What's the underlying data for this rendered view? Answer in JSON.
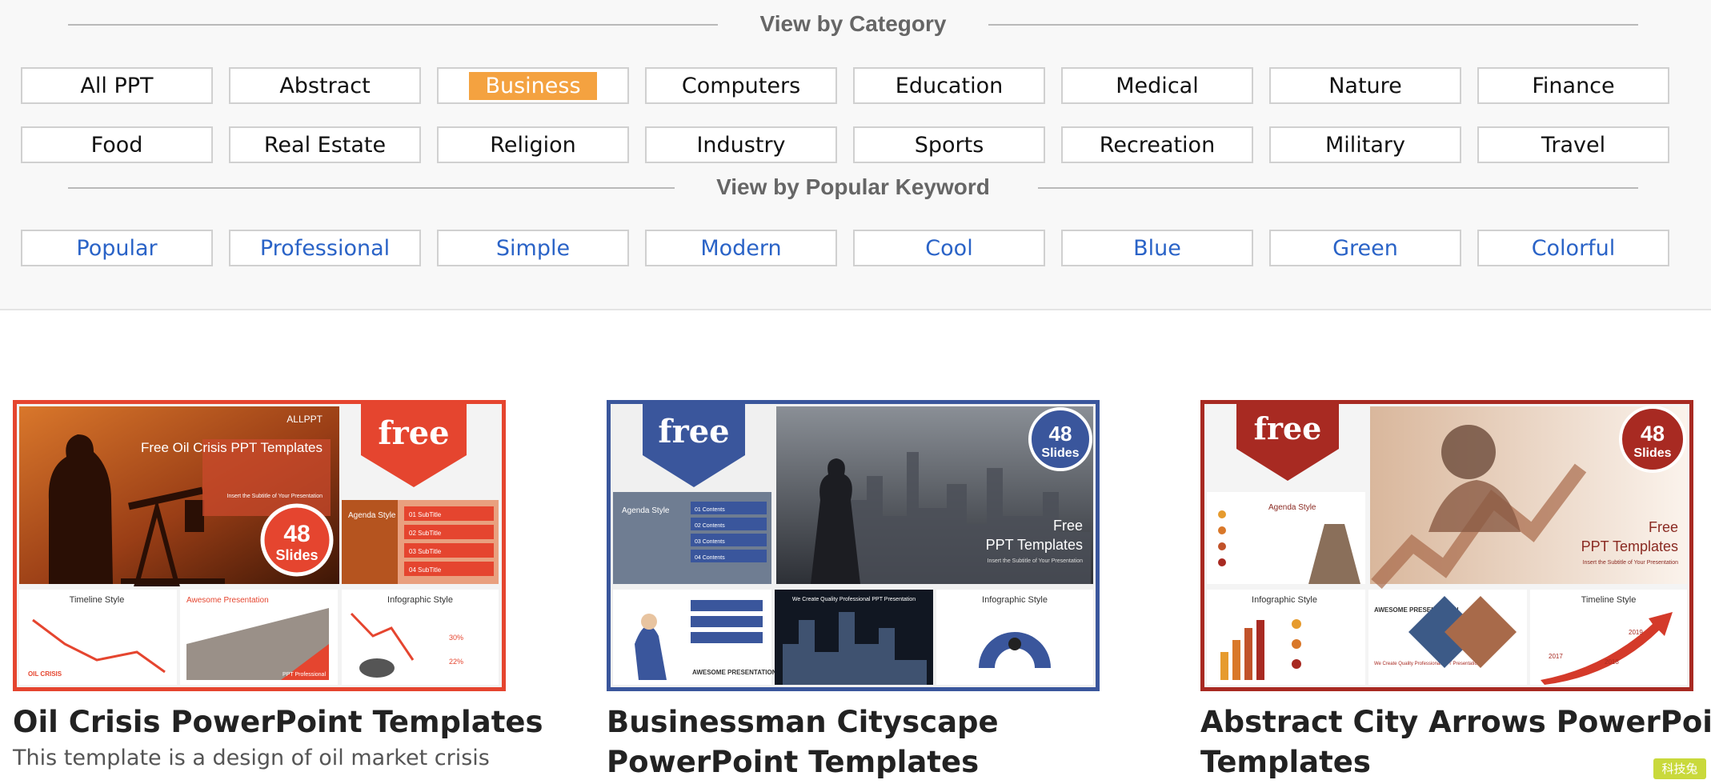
{
  "category_section": {
    "heading": "View by Category",
    "row1": [
      "All PPT",
      "Abstract",
      "Business",
      "Computers",
      "Education",
      "Medical",
      "Nature",
      "Finance"
    ],
    "row2": [
      "Food",
      "Real Estate",
      "Religion",
      "Industry",
      "Sports",
      "Recreation",
      "Military",
      "Travel"
    ],
    "active": "Business"
  },
  "keyword_section": {
    "heading": "View by Popular Keyword",
    "keywords": [
      "Popular",
      "Professional",
      "Simple",
      "Modern",
      "Cool",
      "Blue",
      "Green",
      "Colorful"
    ]
  },
  "colors": {
    "accent": "#f4a240",
    "keyword_link": "#2a63c7",
    "red_border": "#e5452f",
    "blue_border": "#3a569c",
    "darkred_border": "#a82a22"
  },
  "templates": [
    {
      "title": "Oil Crisis PowerPoint Templates",
      "description": "This template is a design of oil market crisis",
      "ribbon": "free",
      "slides_count": "48",
      "slides_label": "Slides",
      "thumb_texts": {
        "logo": "ALLPPT",
        "main": "Free Oil Crisis PPT Templates",
        "subtitle": "Insert the Subtitle of Your Presentation",
        "agenda": "Agenda Style",
        "agenda_items": [
          "01 SubTitle",
          "02 SubTitle",
          "03 SubTitle",
          "04 SubTitle"
        ],
        "timeline": "Timeline Style",
        "awesome": "Awesome Presentation",
        "infographic": "Infographic Style",
        "pct1": "30%",
        "pct2": "22%",
        "oil": "OIL CRISIS",
        "ppt_pro": "PPT Professional"
      }
    },
    {
      "title": "Businessman Cityscape PowerPoint Templates",
      "ribbon": "free",
      "slides_count": "48",
      "slides_label": "Slides",
      "thumb_texts": {
        "main1": "Free",
        "main2": "PPT Templates",
        "subtitle": "Insert the Subtitle of Your Presentation",
        "agenda": "Agenda Style",
        "agenda_items": [
          "01 Contents",
          "02 Contents",
          "03 Contents",
          "04 Contents"
        ],
        "awesome": "AWESOME PRESENTATION",
        "quality": "We Create Quality Professional PPT Presentation",
        "infographic": "Infographic Style"
      }
    },
    {
      "title": "Abstract City Arrows PowerPoint Templates",
      "ribbon": "free",
      "slides_count": "48",
      "slides_label": "Slides",
      "thumb_texts": {
        "main1": "Free",
        "main2": "PPT Templates",
        "subtitle": "Insert the Subtitle of Your Presentation",
        "agenda": "Agenda Style",
        "infographic": "Infographic Style",
        "awesome": "AWESOME PRESENTATION",
        "quality": "We Create Quality Professional PPT Presentation",
        "timeline": "Timeline Style",
        "years": [
          "2017",
          "2018",
          "2019"
        ]
      }
    }
  ],
  "watermark": "科技兔"
}
